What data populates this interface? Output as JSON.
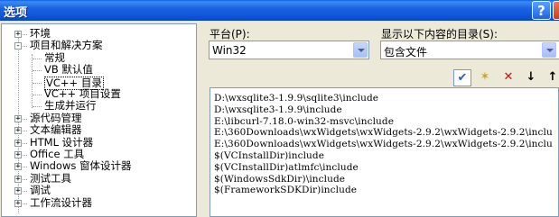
{
  "window": {
    "title": "选项",
    "help_label": "?"
  },
  "tree": {
    "items": [
      {
        "label": "环境",
        "level": 0,
        "expander": "+"
      },
      {
        "label": "项目和解决方案",
        "level": 0,
        "expander": "-"
      },
      {
        "label": "常规",
        "level": 1
      },
      {
        "label": "VB 默认值",
        "level": 1
      },
      {
        "label": "VC++ 目录",
        "level": 1,
        "selected": true
      },
      {
        "label": "VC++ 项目设置",
        "level": 1
      },
      {
        "label": "生成并运行",
        "level": 1
      },
      {
        "label": "源代码管理",
        "level": 0,
        "expander": "+"
      },
      {
        "label": "文本编辑器",
        "level": 0,
        "expander": "+"
      },
      {
        "label": "HTML 设计器",
        "level": 0,
        "expander": "+"
      },
      {
        "label": "Office 工具",
        "level": 0,
        "expander": "+"
      },
      {
        "label": "Windows 窗体设计器",
        "level": 0,
        "expander": "+"
      },
      {
        "label": "测试工具",
        "level": 0,
        "expander": "+"
      },
      {
        "label": "调试",
        "level": 0,
        "expander": "+"
      },
      {
        "label": "工作流设计器",
        "level": 0,
        "expander": "+"
      }
    ]
  },
  "platform": {
    "label": "平台(P):",
    "value": "Win32"
  },
  "show_dirs": {
    "label": "显示以下内容的目录(S):",
    "value": "包含文件"
  },
  "toolbar": [
    {
      "name": "check-button",
      "glyph": "✔"
    },
    {
      "name": "new-folder-button",
      "glyph": "✶"
    },
    {
      "name": "delete-button",
      "glyph": "✕"
    },
    {
      "name": "move-down-button",
      "glyph": "↓"
    },
    {
      "name": "move-up-button",
      "glyph": "↑"
    }
  ],
  "directories": [
    "D:\\wxsqlite3-1.9.9\\sqlite3\\include",
    "D:\\wxsqlite3-1.9.9\\include",
    "E:\\libcurl-7.18.0-win32-msvc\\include",
    "E:\\360Downloads\\wxWidgets\\wxWidgets-2.9.2\\wxWidgets-2.9.2\\inclu",
    "E:\\360Downloads\\wxWidgets\\wxWidgets-2.9.2\\wxWidgets-2.9.2\\inclu",
    "$(VCInstallDir)include",
    "$(VCInstallDir)atlmfc\\include",
    "$(WindowsSdkDir)\\include",
    "$(FrameworkSDKDir)include"
  ],
  "colors": {
    "titlebar": "#0a50d6",
    "dialog_bg": "#ece9d8",
    "border": "#7f9db9"
  }
}
